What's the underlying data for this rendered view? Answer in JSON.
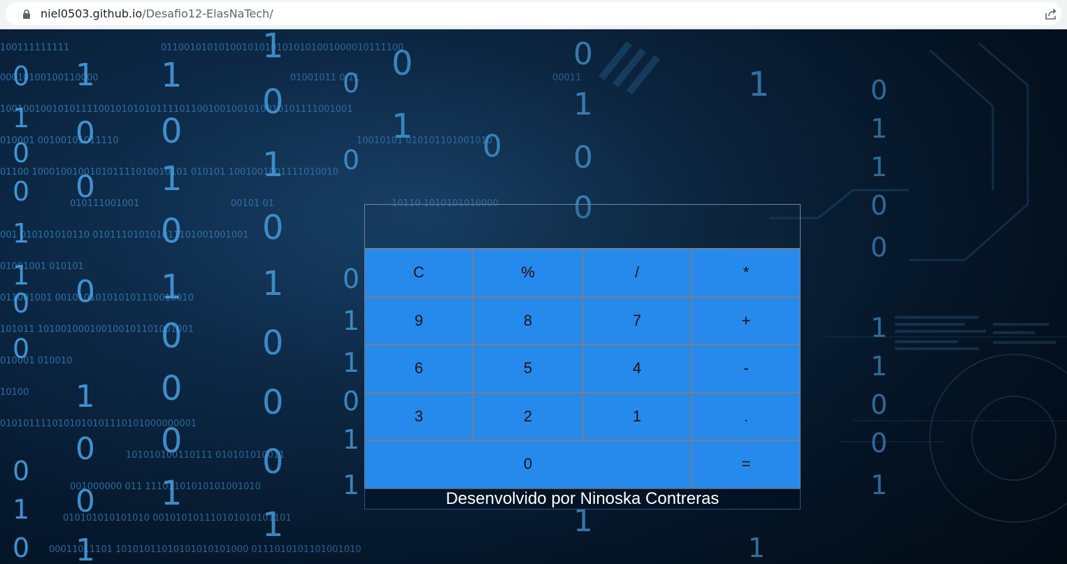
{
  "browser": {
    "url_host": "niel0503.github.io",
    "url_path": "/Desafio12-ElasNaTech/",
    "lock_icon": "lock-icon",
    "share_icon": "share-icon"
  },
  "background": {
    "style": "binary-code-digital-wallpaper",
    "colors": {
      "deep": "#03101e",
      "mid": "#0e2d4d",
      "glow": "#3fa3f5"
    }
  },
  "calculator": {
    "display_value": "",
    "key_color": "#2689ec",
    "keys": [
      {
        "label": "C"
      },
      {
        "label": "%"
      },
      {
        "label": "/"
      },
      {
        "label": "*"
      },
      {
        "label": "9"
      },
      {
        "label": "8"
      },
      {
        "label": "7"
      },
      {
        "label": "+"
      },
      {
        "label": "6"
      },
      {
        "label": "5"
      },
      {
        "label": "4"
      },
      {
        "label": "-"
      },
      {
        "label": "3"
      },
      {
        "label": "2"
      },
      {
        "label": "1"
      },
      {
        "label": "."
      },
      {
        "label": "0"
      },
      {
        "label": "="
      }
    ],
    "footer": "Desenvolvido por Ninoska Contreras"
  }
}
